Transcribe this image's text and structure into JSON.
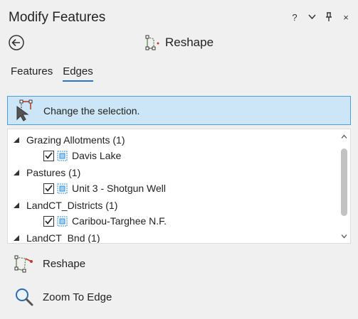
{
  "window": {
    "title": "Modify Features",
    "buttons": [
      "?",
      "⌄",
      "pin",
      "×"
    ]
  },
  "tool": {
    "name": "Reshape",
    "icon": "reshape-icon"
  },
  "tabs": [
    {
      "label": "Features",
      "active": false
    },
    {
      "label": "Edges",
      "active": true
    }
  ],
  "info": {
    "message": "Change the selection.",
    "background": "#cde6f7",
    "border": "#4aa0dc"
  },
  "tree": {
    "groups": [
      {
        "label": "Grazing Allotments (1)",
        "item": "Davis Lake",
        "checked": true
      },
      {
        "label": "Pastures (1)",
        "item": "Unit 3 - Shotgun Well",
        "checked": true
      },
      {
        "label": "LandCT_Districts (1)",
        "item": "Caribou-Targhee N.F.",
        "checked": true
      },
      {
        "label": "LandCT_Bnd (1)"
      }
    ]
  },
  "actions": [
    {
      "label": "Reshape",
      "icon": "reshape-icon"
    },
    {
      "label": "Zoom To Edge",
      "icon": "magnifier-icon"
    }
  ],
  "colors": {
    "accent": "#2b75c7",
    "panel": "#f0f0f0"
  }
}
